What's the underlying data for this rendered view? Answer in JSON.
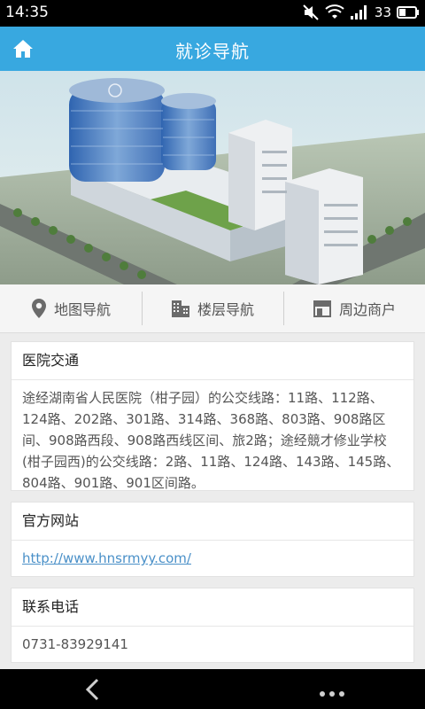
{
  "status_bar": {
    "time": "14:35",
    "battery": "33"
  },
  "header": {
    "title": "就诊导航"
  },
  "nav_tabs": [
    {
      "label": "地图导航",
      "icon": "map-pin-icon"
    },
    {
      "label": "楼层导航",
      "icon": "building-icon"
    },
    {
      "label": "周边商户",
      "icon": "store-icon"
    }
  ],
  "cards": {
    "transport": {
      "title": "医院交通",
      "text": "途经湖南省人民医院（柑子园）的公交线路：11路、112路、124路、202路、301路、314路、368路、803路、908路区间、908路西段、908路西线区间、旅2路；途经競才修业学校(柑子园西)的公交线路：2路、11路、124路、143路、145路、804路、901路、901区间路。"
    },
    "website": {
      "title": "官方网站",
      "url": "http://www.hnsrmyy.com/"
    },
    "phone": {
      "title": "联系电话",
      "number": "0731-83929141"
    }
  },
  "colors": {
    "accent": "#38a8e0",
    "link": "#4a90c8"
  }
}
